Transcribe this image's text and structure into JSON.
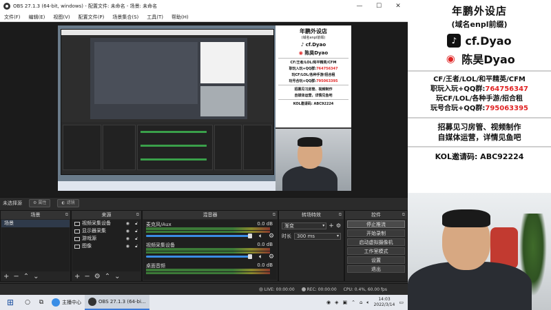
{
  "window": {
    "title": "OBS 27.1.3 (64-bit, windows) - 配置文件: 未命名 - 场景: 未命名",
    "controls": [
      "—",
      "☐",
      "✕"
    ]
  },
  "menu": [
    "文件(F)",
    "编辑(E)",
    "视图(V)",
    "配置文件(P)",
    "场景集合(S)",
    "工具(T)",
    "帮助(H)"
  ],
  "canvas_overlay": {
    "heading": "年鹏外设店",
    "sub": "(域名enpl前缀)",
    "tiktok": "cf.Dyao",
    "weibo": "陈昊Dyao",
    "line1": "CF/王者/LOL/和平精英/CFM",
    "line2_prefix": "职玩入玩+QQ群:",
    "line2_num": "764756347",
    "line3": "玩CF/LOL/各种手游/招合租",
    "line4_prefix": "玩号合玩+QQ群:",
    "line4_num": "795063395",
    "line5": "招募见习房管、视频制作",
    "line6": "自媒体运营，详情见鱼吧",
    "kol": "KOL邀请码: ABC92224"
  },
  "no_source": {
    "label": "未选择源",
    "properties": "属性",
    "filters": "滤镜"
  },
  "docks": {
    "scenes": {
      "title": "场景",
      "items": [
        "场景"
      ]
    },
    "sources": {
      "title": "来源",
      "items": [
        "视频采集设备",
        "显示器采集",
        "游戏源",
        "图像"
      ]
    },
    "mixer": {
      "title": "混音器",
      "channels": [
        {
          "name": "麦克风/Aux",
          "db": "0.0 dB"
        },
        {
          "name": "视频采集设备",
          "db": "0.0 dB"
        },
        {
          "name": "桌面音频",
          "db": "0.0 dB"
        }
      ]
    },
    "transitions": {
      "title": "转场特效",
      "selected": "渐变",
      "duration_label": "时长",
      "duration": "300 ms"
    },
    "controls": {
      "title": "控件",
      "buttons": [
        "停止推流",
        "开始录制",
        "启动虚拟摄像机",
        "工作室模式",
        "设置",
        "退出"
      ]
    }
  },
  "status": {
    "live": "LIVE: 00:00:00",
    "rec": "REC: 00:00:00",
    "cpu": "CPU: 0.4%, 60.00 fps"
  },
  "taskbar": {
    "app1": "主播中心",
    "app2": "OBS 27.1.3 (64-bi...",
    "time": "14:03",
    "date": "2022/3/14"
  },
  "side_panel": {
    "heading": "年鹏外设店",
    "sub": "(域名enpl前缀)",
    "tiktok": "cf.Dyao",
    "weibo": "陈昊Dyao",
    "line1": "CF/王者/LOL/和平精英/CFM",
    "line2_prefix": "职玩入玩+QQ群:",
    "line2_num": "764756347",
    "line3": "玩CF/LOL/各种手游/招合租",
    "line4_prefix": "玩号合玩+QQ群:",
    "line4_num": "795063395",
    "line5": "招募见习房管、视频制作",
    "line6": "自媒体运营，详情见鱼吧",
    "kol": "KOL邀请码: ABC92224"
  },
  "icons": {
    "tiktok": "tiktok-icon",
    "weibo": "weibo-icon",
    "windows": "windows-start-icon"
  },
  "colors": {
    "accent_red": "#e02424",
    "obs_dark": "#2b2b2b",
    "slider_blue": "#3a8ee6"
  }
}
